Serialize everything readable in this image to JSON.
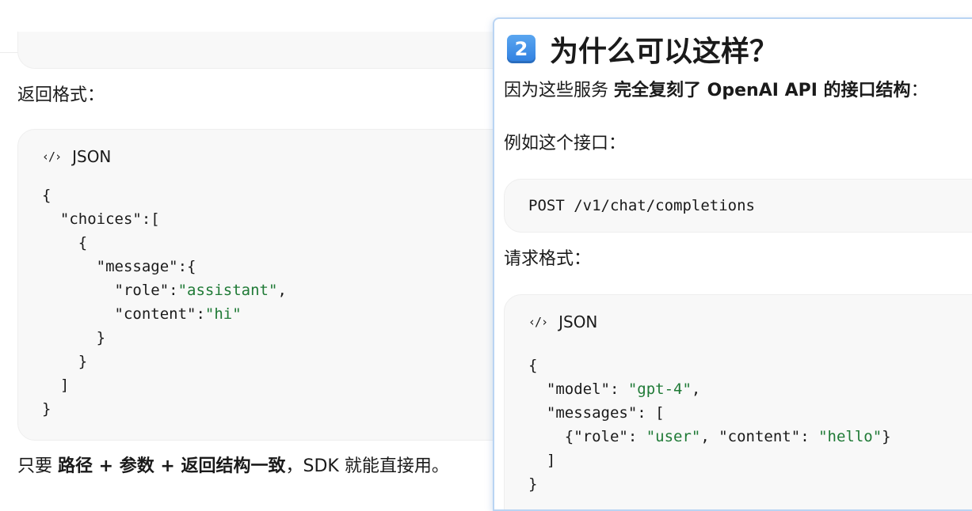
{
  "left": {
    "returns_label": "返回格式：",
    "response_code": {
      "lang": "JSON",
      "lines": [
        [
          {
            "t": "{"
          }
        ],
        [
          {
            "t": "  \"choices\":["
          }
        ],
        [
          {
            "t": "    {"
          }
        ],
        [
          {
            "t": "      \"message\":{"
          }
        ],
        [
          {
            "t": "        \"role\":"
          },
          {
            "t": "\"assistant\"",
            "s": 1
          },
          {
            "t": ","
          }
        ],
        [
          {
            "t": "        \"content\":"
          },
          {
            "t": "\"hi\"",
            "s": 1
          }
        ],
        [
          {
            "t": "      }"
          }
        ],
        [
          {
            "t": "    }"
          }
        ],
        [
          {
            "t": "  ]"
          }
        ],
        [
          {
            "t": "}"
          }
        ]
      ]
    },
    "conclusion": {
      "prefix": "只要 ",
      "bold": "路径 + 参数 + 返回结构一致",
      "suffix": "，SDK 就能直接用。"
    }
  },
  "panel": {
    "number": "2",
    "title": "为什么可以这样？",
    "intro": {
      "prefix": "因为这些服务 ",
      "bold": "完全复刻了 OpenAI API 的接口结构",
      "suffix": "："
    },
    "example_label": "例如这个接口：",
    "endpoint": "POST /v1/chat/completions",
    "request_label": "请求格式：",
    "request_code": {
      "lang": "JSON",
      "lines": [
        [
          {
            "t": "{"
          }
        ],
        [
          {
            "t": "  \"model\": "
          },
          {
            "t": "\"gpt-4\"",
            "s": 1
          },
          {
            "t": ","
          }
        ],
        [
          {
            "t": "  \"messages\": ["
          }
        ],
        [
          {
            "t": "    {\"role\": "
          },
          {
            "t": "\"user\"",
            "s": 1
          },
          {
            "t": ", \"content\": "
          },
          {
            "t": "\"hello\"",
            "s": 1
          },
          {
            "t": "}"
          }
        ],
        [
          {
            "t": "  ]"
          }
        ],
        [
          {
            "t": "}"
          }
        ]
      ]
    }
  }
}
